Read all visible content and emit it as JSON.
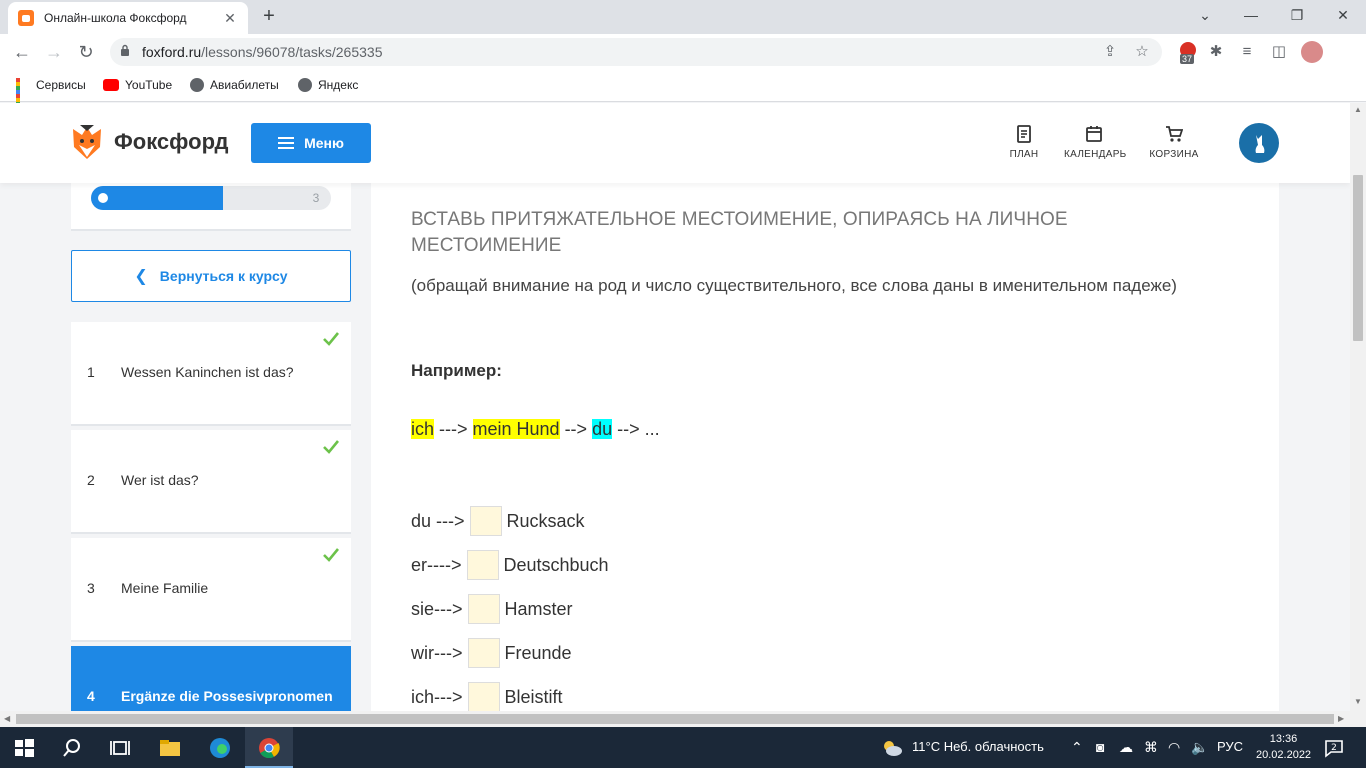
{
  "browser": {
    "tab_title": "Онлайн-школа Фоксфорд",
    "url_host": "foxford.ru",
    "url_path": "/lessons/96078/tasks/265335",
    "extension_badge": "37",
    "bookmarks": [
      {
        "label": "Сервисы"
      },
      {
        "label": "YouTube"
      },
      {
        "label": "Авиабилеты"
      },
      {
        "label": "Яндекс"
      }
    ]
  },
  "header": {
    "logo_text": "Фоксфорд",
    "menu_label": "Меню",
    "nav": [
      {
        "label": "ПЛАН"
      },
      {
        "label": "КАЛЕНДАРЬ"
      },
      {
        "label": "КОРЗИНА"
      }
    ]
  },
  "sidebar": {
    "progress_total": "3",
    "progress_fraction": 0.55,
    "back_label": "Вернуться к курсу",
    "lessons": [
      {
        "num": "1",
        "title": "Wessen Kaninchen ist das?",
        "done": true
      },
      {
        "num": "2",
        "title": "Wer ist das?",
        "done": true
      },
      {
        "num": "3",
        "title": "Meine Familie",
        "done": true
      },
      {
        "num": "4",
        "title": "Ergänze die Possesivpronomen",
        "done": false,
        "active": true
      }
    ]
  },
  "task": {
    "title": "ВСТАВЬ ПРИТЯЖАТЕЛЬНОЕ МЕСТОИМЕНИЕ, ОПИРАЯСЬ НА ЛИЧНОЕ МЕСТОИМЕНИЕ",
    "subtitle": "(обращай внимание на род и число существительного, все слова даны в именительном падеже)",
    "example_label": "Например:",
    "example": {
      "p1": "ich",
      "a1": " ---> ",
      "p2": "mein Hund",
      "a2": " --> ",
      "p3": "du",
      "a3": " --> ..."
    },
    "rows": [
      {
        "pron": "du --->",
        "noun": "Rucksack"
      },
      {
        "pron": "er---->",
        "noun": "Deutschbuch"
      },
      {
        "pron": "sie--->",
        "noun": "Hamster"
      },
      {
        "pron": "wir--->",
        "noun": "Freunde"
      },
      {
        "pron": "ich--->",
        "noun": "Bleistift"
      }
    ]
  },
  "taskbar": {
    "weather": "11°C  Неб. облачность",
    "lang": "РУС",
    "time": "13:36",
    "date": "20.02.2022"
  },
  "colors": {
    "brand_blue": "#1e88e5",
    "highlight_yellow": "#ffff00",
    "highlight_cyan": "#00ffff",
    "check_green": "#6cc24a"
  }
}
